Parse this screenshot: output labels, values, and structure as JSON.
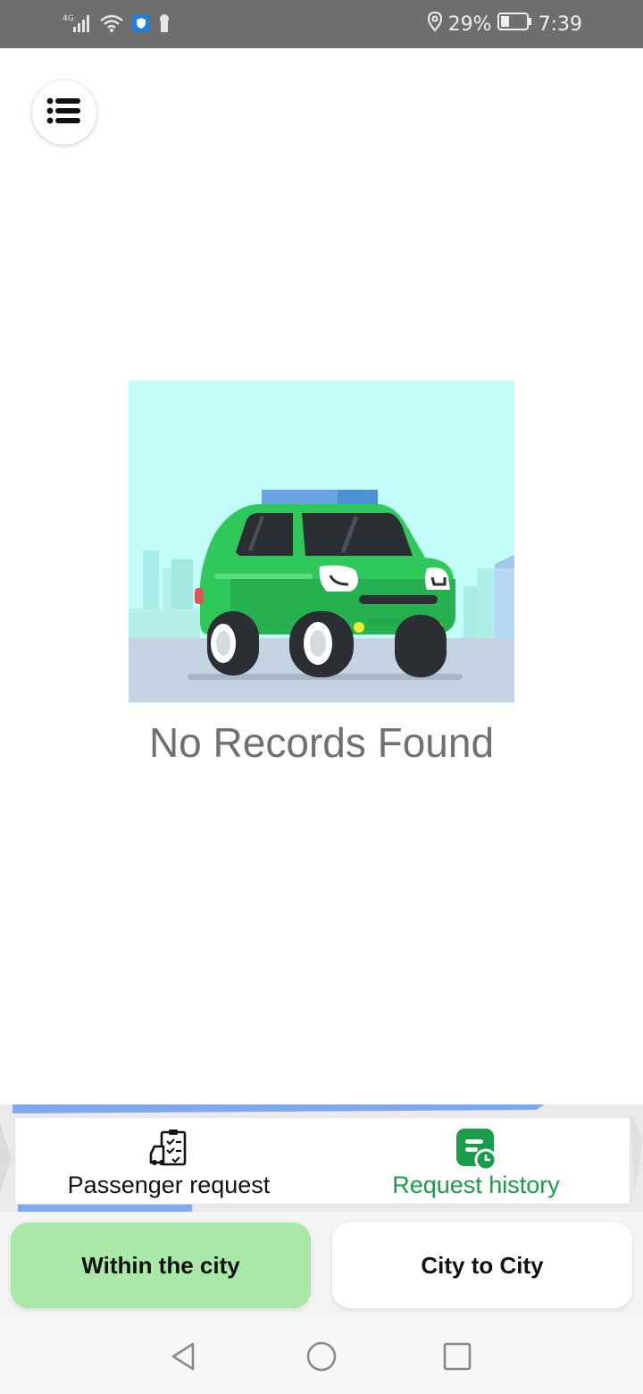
{
  "status_bar": {
    "network": "4G",
    "battery": "29%",
    "time": "7:39"
  },
  "menu": {
    "icon": "list-menu-icon"
  },
  "empty_state": {
    "message": "No Records Found",
    "illustration": "green-car-illustration"
  },
  "tabs": [
    {
      "label": "Passenger request",
      "icon": "clipboard-car-icon",
      "active": false
    },
    {
      "label": "Request history",
      "icon": "history-clock-icon",
      "active": true
    }
  ],
  "segments": {
    "within_city": "Within the city",
    "city_to_city": "City to City",
    "selected": "within_city"
  },
  "colors": {
    "accent_green": "#1a9c4a",
    "selected_segment": "#a9e8a9",
    "illustration_sky": "#c3fdfa",
    "car_green": "#2ec95a"
  },
  "nav": {
    "back": "back-triangle-icon",
    "home": "home-circle-icon",
    "recents": "recents-square-icon"
  }
}
